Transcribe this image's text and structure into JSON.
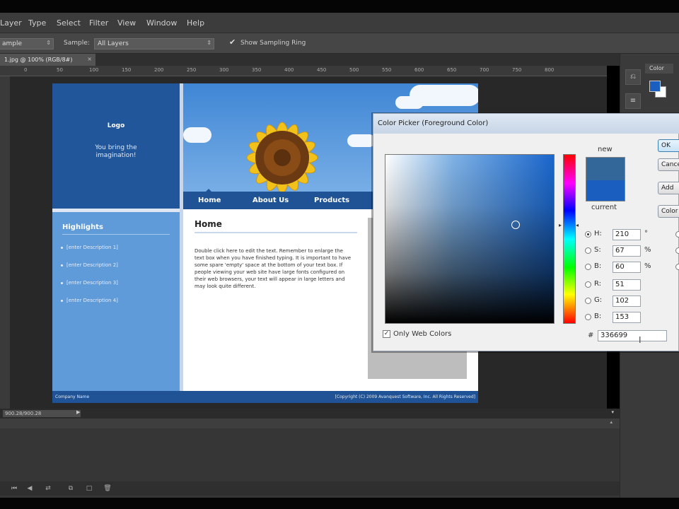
{
  "menu": [
    "Layer",
    "Type",
    "Select",
    "Filter",
    "View",
    "Window",
    "Help"
  ],
  "options": {
    "sample_size_value": "ample",
    "sample_label": "Sample:",
    "sample_value": "All Layers",
    "show_sampling_ring_label": "Show Sampling Ring"
  },
  "document_tab": "1.jpg @ 100% (RGB/8#)",
  "ruler_ticks": [
    "0",
    "50",
    "100",
    "150",
    "200",
    "250",
    "300",
    "350",
    "400",
    "450",
    "500",
    "550",
    "600",
    "650",
    "700",
    "750",
    "800"
  ],
  "site": {
    "logo": "Logo",
    "tagline": "You bring the imagination!",
    "nav": [
      "Home",
      "About Us",
      "Products"
    ],
    "highlights_title": "Highlights",
    "highlights": [
      "[enter Description 1]",
      "[enter Description 2]",
      "[enter Description 3]",
      "[enter Description 4]"
    ],
    "content_title": "Home",
    "content_text": "Double click here to edit the text. Remember to enlarge the text box when you have finished typing. It is important to have some spare 'empty' space at the bottom of your text box. If people viewing your web site have large fonts configured on their web browsers, your text will appear in large letters and may look quite different.",
    "footer_left": "Company Name",
    "footer_right": "[Copyright (C) 2009 Avanquest Software, Inc. All Rights Reserved]"
  },
  "color_picker": {
    "title": "Color Picker (Foreground Color)",
    "new_label": "new",
    "current_label": "current",
    "new_color": "#336699",
    "current_color": "#1a5fbf",
    "h_label": "H:",
    "h_value": "210",
    "h_unit": "°",
    "s_label": "S:",
    "s_value": "67",
    "s_unit": "%",
    "b_label": "B:",
    "b_value": "60",
    "b_unit": "%",
    "r_label": "R:",
    "r_value": "51",
    "g_label": "G:",
    "g_value": "102",
    "bl_label": "B:",
    "bl_value": "153",
    "hash_label": "#",
    "hex_value": "336699",
    "only_web_colors": "Only Web Colors",
    "only_web_colors_checked": true,
    "buttons": [
      "OK",
      "Cancel",
      "Add",
      "Color"
    ]
  },
  "right_panel": {
    "color_tab": "Color"
  },
  "timeline": {
    "zoom_field": "900.28/900.28"
  }
}
